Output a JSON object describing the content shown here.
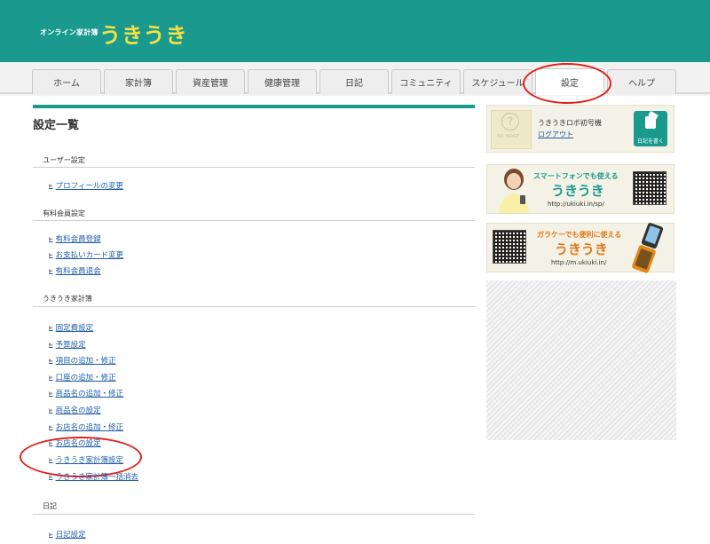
{
  "header": {
    "brand_small": "オンライン家計簿",
    "brand_logo": "うきうき"
  },
  "nav": {
    "tabs": [
      "ホーム",
      "家計簿",
      "資産管理",
      "健康管理",
      "日記",
      "コミュニティ",
      "スケジュール",
      "設定",
      "ヘルプ"
    ],
    "active": "設定"
  },
  "main": {
    "title": "設定一覧",
    "sections": [
      {
        "title": "ユーザー設定",
        "links": [
          "プロフィールの変更"
        ]
      },
      {
        "title": "有料会員設定",
        "links": [
          "有料会員登録",
          "お支払いカード変更",
          "有料会員退会"
        ]
      },
      {
        "title": "うきうき家計簿",
        "links": [
          "固定費設定",
          "予算設定",
          "項目の追加・修正",
          "口座の追加・修正",
          "商品名の追加・修正",
          "商品名の設定",
          "お店名の追加・修正",
          "お店名の設定",
          "うきうき家計簿設定",
          "うきうき家計簿一括消去"
        ]
      },
      {
        "title": "日記",
        "links": [
          "日記設定"
        ]
      }
    ]
  },
  "sidebar": {
    "user": {
      "noimage": "NO IMAGE",
      "name": "うきうきロボ初号機",
      "logout": "ログアウト",
      "diary_button": "日記を書く"
    },
    "sp_banner": {
      "small": "スマートフォンでも使える",
      "big": "うきうき",
      "url": "http://ukiuki.in/sp/"
    },
    "m_banner": {
      "small": "ガラケーでも便利に使える",
      "big": "うきうき",
      "url": "http://m.ukiuki.in/"
    }
  },
  "colors": {
    "brand_teal": "#1a9a8e",
    "logo_yellow": "#f3e043",
    "link_blue": "#1d5ca8",
    "annotation_red": "#e0201b"
  }
}
